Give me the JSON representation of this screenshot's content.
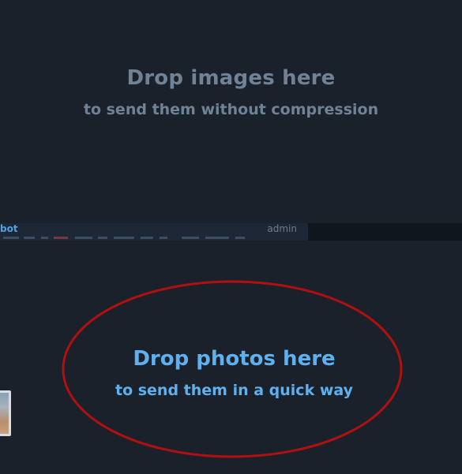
{
  "drop_images": {
    "title": "Drop images here",
    "subtitle": "to send them without compression"
  },
  "message_strip": {
    "sender": "bot",
    "role": "admin"
  },
  "drop_photos": {
    "title": "Drop photos here",
    "subtitle": "to send them in a quick way",
    "highlight_color": "#b01010"
  },
  "colors": {
    "background": "#1a212b",
    "drop_images_text": "#6f8296",
    "drop_photos_text": "#5fb0ee",
    "sender_name": "#4fa3e0"
  }
}
